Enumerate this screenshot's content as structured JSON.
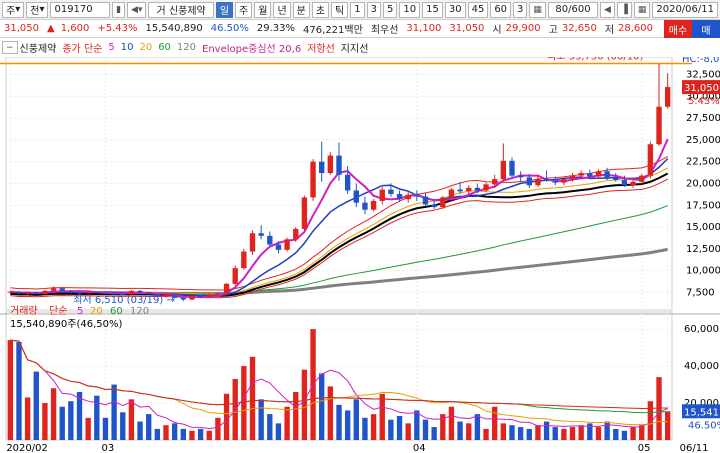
{
  "toolbar": {
    "menu1": "주",
    "menu2": "전",
    "code": "019170",
    "name_prefix": "거",
    "name": "신풍제약",
    "periods": [
      "일",
      "주",
      "월",
      "년",
      "분",
      "초",
      "틱"
    ],
    "nums": [
      "1",
      "3",
      "5",
      "10",
      "15",
      "30",
      "45",
      "60",
      "3"
    ],
    "count": "80/600",
    "date": "2020/06/11"
  },
  "quote": {
    "price": "31,050",
    "arrow": "▲",
    "change": "1,600",
    "rate": "+5.43%",
    "volume": "15,540,890",
    "vol_ratio": "46.50%",
    "turnover": "29.33%",
    "amount": "476,221백만",
    "category": "최우선",
    "ask": "31,100",
    "bid": "31,050",
    "open_label": "시",
    "open": "29,900",
    "high_label": "고",
    "high": "32,650",
    "low_label": "저",
    "low": "28,600"
  },
  "right_buttons": {
    "buy": "매수",
    "sell": "매"
  },
  "price_panel": {
    "name": "신풍제약",
    "ma_label": "종가 단순",
    "ma_periods": [
      "5",
      "10",
      "20",
      "60",
      "120"
    ],
    "envelope": "Envelope중심선 20,6",
    "resistance": "저항선",
    "support": "지지선",
    "max_label": "최고 33,750 (06/10)",
    "min_label": "최저 6,510 (03/19)",
    "current_price": "31,050",
    "current_rate": "5.43%",
    "lc": "LC:376,",
    "hc": "HC:-8,0"
  },
  "volume_panel": {
    "title": "거래량",
    "ma_label": "단순",
    "ma_periods": [
      "5",
      "20",
      "60",
      "120"
    ],
    "current": "15,540,890주(46,50%)",
    "current_tag": "15,541",
    "rate_tag": "46.50%"
  },
  "colors": {
    "up": "#e0241d",
    "down": "#1f55c8",
    "ma5": "#d01ec8",
    "ma10": "#1f3fbf",
    "ma20": "#e8a000",
    "ma60": "#1e9a3a",
    "ma120": "#808080",
    "env": "#c81e8c",
    "highline": "#ff8c00"
  },
  "chart_data": {
    "type": "candlestick",
    "y_ticks": [
      "32,500",
      "30,000",
      "27,500",
      "25,000",
      "22,500",
      "20,000",
      "17,500",
      "15,000",
      "12,500",
      "10,000",
      "7,500"
    ],
    "y_range": [
      5500,
      34500
    ],
    "vol_ticks": [
      "60,000",
      "40,000",
      "20,000"
    ],
    "vol_range": [
      0,
      66000
    ],
    "x_labels": [
      "2020/02",
      "03",
      "04",
      "05",
      "06",
      "06/11"
    ],
    "candles": [
      [
        7500,
        7700,
        7400,
        7600
      ],
      [
        7600,
        7700,
        7300,
        7400
      ],
      [
        7400,
        7600,
        7200,
        7500
      ],
      [
        7500,
        7650,
        7300,
        7350
      ],
      [
        7350,
        7800,
        7300,
        7700
      ],
      [
        7700,
        8200,
        7500,
        8000
      ],
      [
        8000,
        8100,
        7600,
        7700
      ],
      [
        7700,
        7800,
        7400,
        7500
      ],
      [
        7500,
        7600,
        7300,
        7450
      ],
      [
        7450,
        7600,
        7350,
        7550
      ],
      [
        7550,
        7600,
        7400,
        7450
      ],
      [
        7450,
        7550,
        7300,
        7400
      ],
      [
        7400,
        7500,
        7250,
        7350
      ],
      [
        7350,
        7450,
        7200,
        7300
      ],
      [
        7300,
        7800,
        7250,
        7700
      ],
      [
        7700,
        7800,
        7400,
        7500
      ],
      [
        7500,
        7600,
        7200,
        7300
      ],
      [
        7300,
        7400,
        7000,
        7100
      ],
      [
        7100,
        7300,
        6900,
        7200
      ],
      [
        7200,
        7300,
        6800,
        6900
      ],
      [
        6900,
        7000,
        6510,
        6700
      ],
      [
        6700,
        7200,
        6600,
        7100
      ],
      [
        7100,
        7300,
        6900,
        7000
      ],
      [
        7000,
        7400,
        6900,
        7300
      ],
      [
        7300,
        7500,
        7100,
        7400
      ],
      [
        7400,
        8600,
        7300,
        8500
      ],
      [
        8500,
        10600,
        8300,
        10300
      ],
      [
        10300,
        12500,
        10100,
        12200
      ],
      [
        12200,
        14600,
        11800,
        14300
      ],
      [
        14300,
        15200,
        13600,
        14000
      ],
      [
        14000,
        14500,
        12800,
        13000
      ],
      [
        13000,
        13400,
        12000,
        12400
      ],
      [
        12400,
        13800,
        12200,
        13600
      ],
      [
        13600,
        15000,
        13300,
        14800
      ],
      [
        14800,
        18600,
        14600,
        18400
      ],
      [
        18400,
        22800,
        18000,
        22500
      ],
      [
        22500,
        24800,
        20200,
        21200
      ],
      [
        21200,
        23600,
        21000,
        23200
      ],
      [
        23200,
        24700,
        20300,
        21000
      ],
      [
        21000,
        22000,
        18800,
        19200
      ],
      [
        19200,
        20000,
        17300,
        17800
      ],
      [
        17800,
        18500,
        16500,
        17000
      ],
      [
        17000,
        18200,
        16800,
        18000
      ],
      [
        18000,
        19600,
        17600,
        19300
      ],
      [
        19300,
        20000,
        18500,
        18800
      ],
      [
        18800,
        19200,
        17900,
        18200
      ],
      [
        18200,
        19000,
        17800,
        18700
      ],
      [
        18700,
        19200,
        18000,
        18500
      ],
      [
        18500,
        18900,
        17400,
        17600
      ],
      [
        17600,
        18000,
        17100,
        17300
      ],
      [
        17300,
        18600,
        17100,
        18400
      ],
      [
        18400,
        19500,
        18200,
        19300
      ],
      [
        19300,
        20200,
        18800,
        19100
      ],
      [
        19100,
        19800,
        18700,
        19500
      ],
      [
        19500,
        20000,
        18900,
        19200
      ],
      [
        19200,
        20100,
        19000,
        19900
      ],
      [
        19900,
        21000,
        19500,
        20500
      ],
      [
        20500,
        24600,
        20300,
        22600
      ],
      [
        22600,
        23000,
        20600,
        20900
      ],
      [
        20900,
        21400,
        20200,
        20700
      ],
      [
        20700,
        21100,
        19500,
        19800
      ],
      [
        19800,
        21000,
        19600,
        20500
      ],
      [
        20500,
        21500,
        20200,
        20300
      ],
      [
        20300,
        20800,
        19800,
        20100
      ],
      [
        20100,
        20700,
        19800,
        20500
      ],
      [
        20500,
        21200,
        20200,
        20900
      ],
      [
        20900,
        21500,
        20500,
        21200
      ],
      [
        21200,
        21600,
        20600,
        20800
      ],
      [
        20800,
        21600,
        20600,
        21400
      ],
      [
        21400,
        21800,
        20400,
        20600
      ],
      [
        20600,
        21200,
        20200,
        20400
      ],
      [
        20400,
        20900,
        19600,
        19800
      ],
      [
        19800,
        20400,
        19500,
        20200
      ],
      [
        20200,
        21100,
        19900,
        20900
      ],
      [
        20900,
        24800,
        20600,
        24500
      ],
      [
        24500,
        33750,
        24300,
        28800
      ],
      [
        28800,
        32650,
        28600,
        31050
      ]
    ],
    "volumes": [
      54000,
      53000,
      23000,
      37000,
      20000,
      28000,
      18000,
      21000,
      26000,
      12000,
      24000,
      12000,
      30000,
      15000,
      22000,
      10000,
      14000,
      6000,
      8000,
      9000,
      6000,
      5000,
      6000,
      5000,
      12000,
      25000,
      33000,
      40000,
      45000,
      22000,
      14000,
      9000,
      18000,
      26000,
      38000,
      60000,
      36000,
      29000,
      19000,
      16000,
      22000,
      12000,
      14000,
      25000,
      11000,
      13000,
      9000,
      16000,
      11000,
      7000,
      14000,
      18000,
      10000,
      9000,
      14000,
      6000,
      18000,
      9000,
      8000,
      7000,
      6000,
      8000,
      10000,
      7000,
      6000,
      7000,
      8000,
      9000,
      7000,
      10000,
      6000,
      5000,
      7000,
      8000,
      21000,
      34000,
      15541
    ]
  },
  "tick_value": {
    "last_label": "31,050"
  }
}
